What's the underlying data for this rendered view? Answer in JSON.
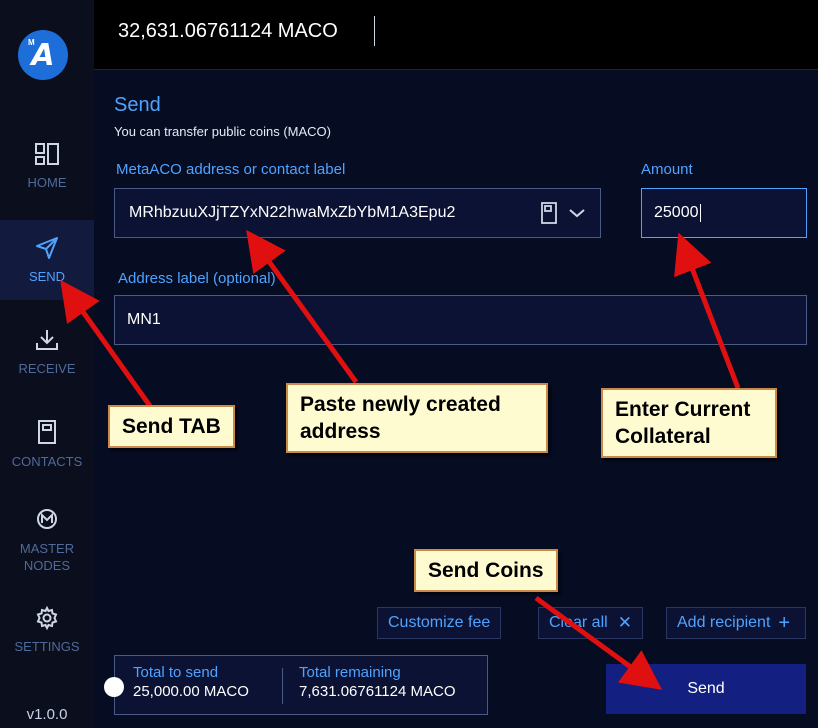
{
  "app": {
    "logo_letter": "A",
    "logo_small": "M",
    "version": "v1.0.0",
    "balance": "32,631.06761124 MACO"
  },
  "sidebar": {
    "items": [
      {
        "label": "HOME",
        "icon": "home-icon",
        "active": false
      },
      {
        "label": "SEND",
        "icon": "send-icon",
        "active": true
      },
      {
        "label": "RECEIVE",
        "icon": "receive-icon",
        "active": false
      },
      {
        "label": "CONTACTS",
        "icon": "contacts-icon",
        "active": false
      },
      {
        "label_line1": "MASTER",
        "label_line2": "NODES",
        "icon": "masternodes-icon",
        "active": false
      },
      {
        "label": "SETTINGS",
        "icon": "gear-icon",
        "active": false
      }
    ]
  },
  "send": {
    "title": "Send",
    "subtitle": "You can transfer public coins (MACO)",
    "address_label": "MetaACO address or contact label",
    "address_value": "MRhbzuuXJjTZYxN22hwaMxZbYbM1A3Epu2",
    "amount_label": "Amount",
    "amount_value": "25000",
    "addr_label_label": "Address label (optional)",
    "addr_label_value": "MN1"
  },
  "actions": {
    "customize_fee": "Customize fee",
    "clear_all": "Clear all",
    "clear_all_icon": "✕",
    "add_recipient": "Add recipient",
    "add_recipient_icon": "+",
    "send": "Send"
  },
  "totals": {
    "total_to_send_label": "Total to send",
    "total_to_send_value": "25,000.00 MACO",
    "total_remaining_label": "Total remaining",
    "total_remaining_value": "7,631.06761124 MACO"
  },
  "annotations": {
    "send_tab": "Send TAB",
    "paste_line1": "Paste newly created",
    "paste_line2": "address",
    "collateral_line1": "Enter Current",
    "collateral_line2": "Collateral",
    "send_coins": "Send Coins"
  },
  "colors": {
    "accent": "#4fa3ff",
    "sidebar_bg": "#0b0e1c",
    "main_bg": "#060c22",
    "send_button": "#132081",
    "arrow": "#e01010",
    "callout_bg": "#fffbd0"
  }
}
